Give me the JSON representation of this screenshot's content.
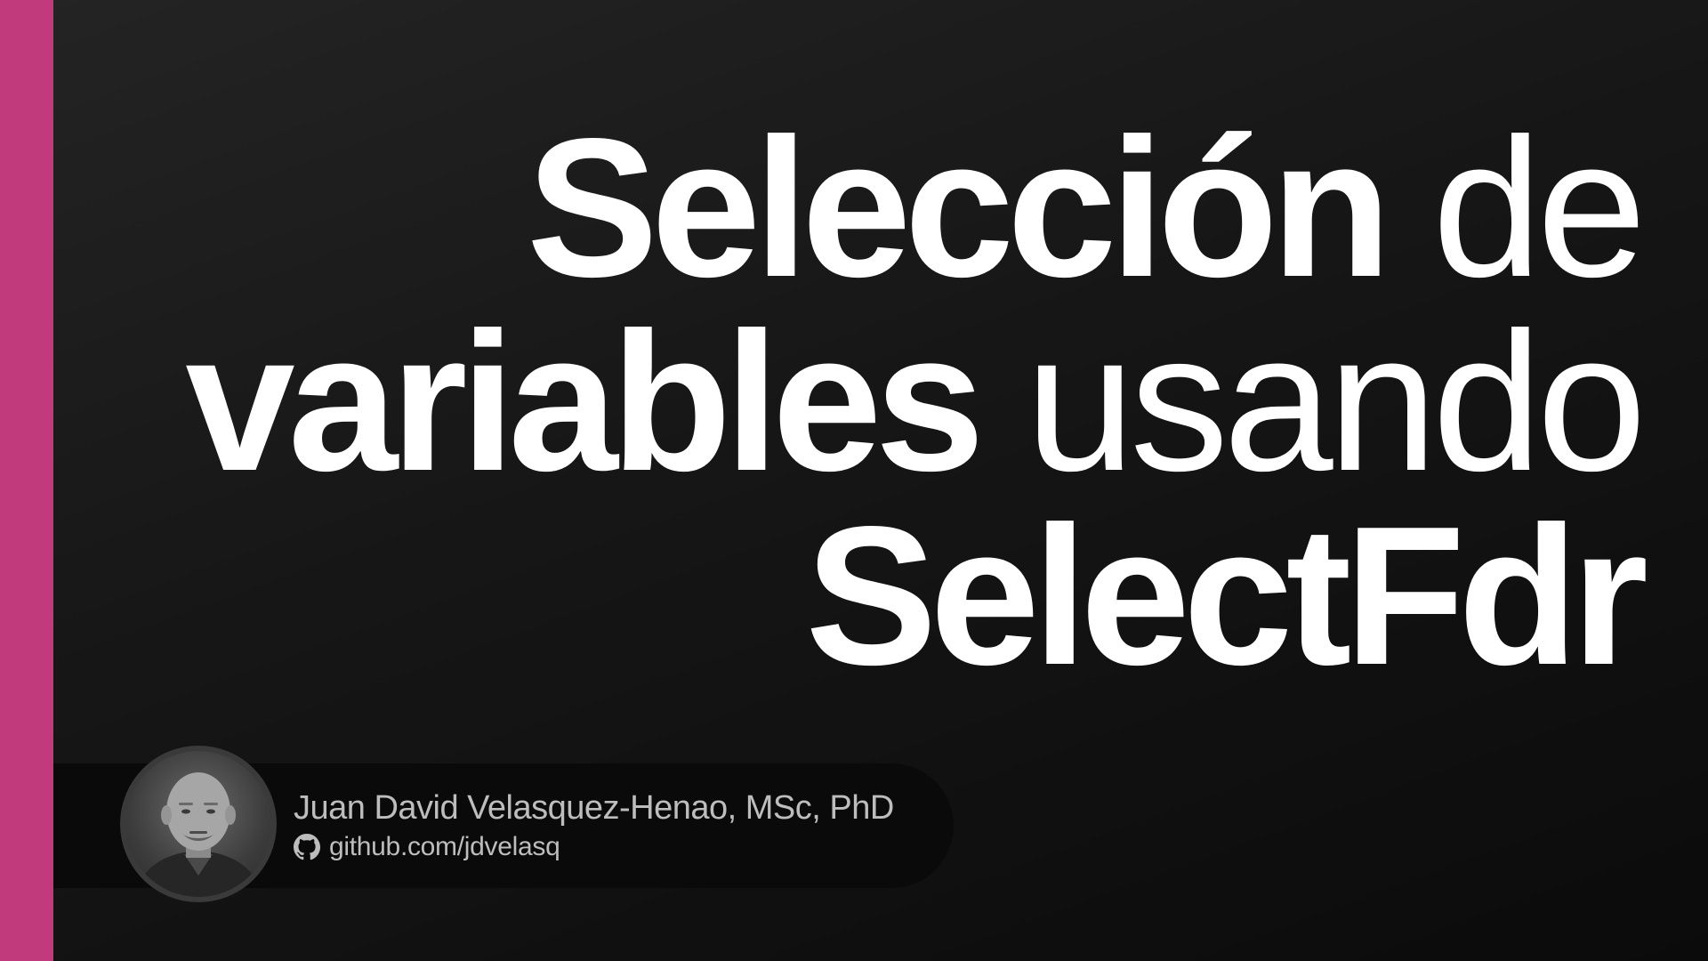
{
  "title": {
    "line1_bold": "Selección",
    "line1_light": "de",
    "line2_bold": "variables",
    "line2_light": "usando",
    "line3_bold": "SelectFdr"
  },
  "author": {
    "name": "Juan David Velasquez-Henao, MSc, PhD",
    "url": "github.com/jdvelasq",
    "icon": "github-icon"
  },
  "colors": {
    "accent": "#c03a7c",
    "background": "#161616",
    "text": "#ffffff",
    "muted_text": "#bdbdbd"
  }
}
